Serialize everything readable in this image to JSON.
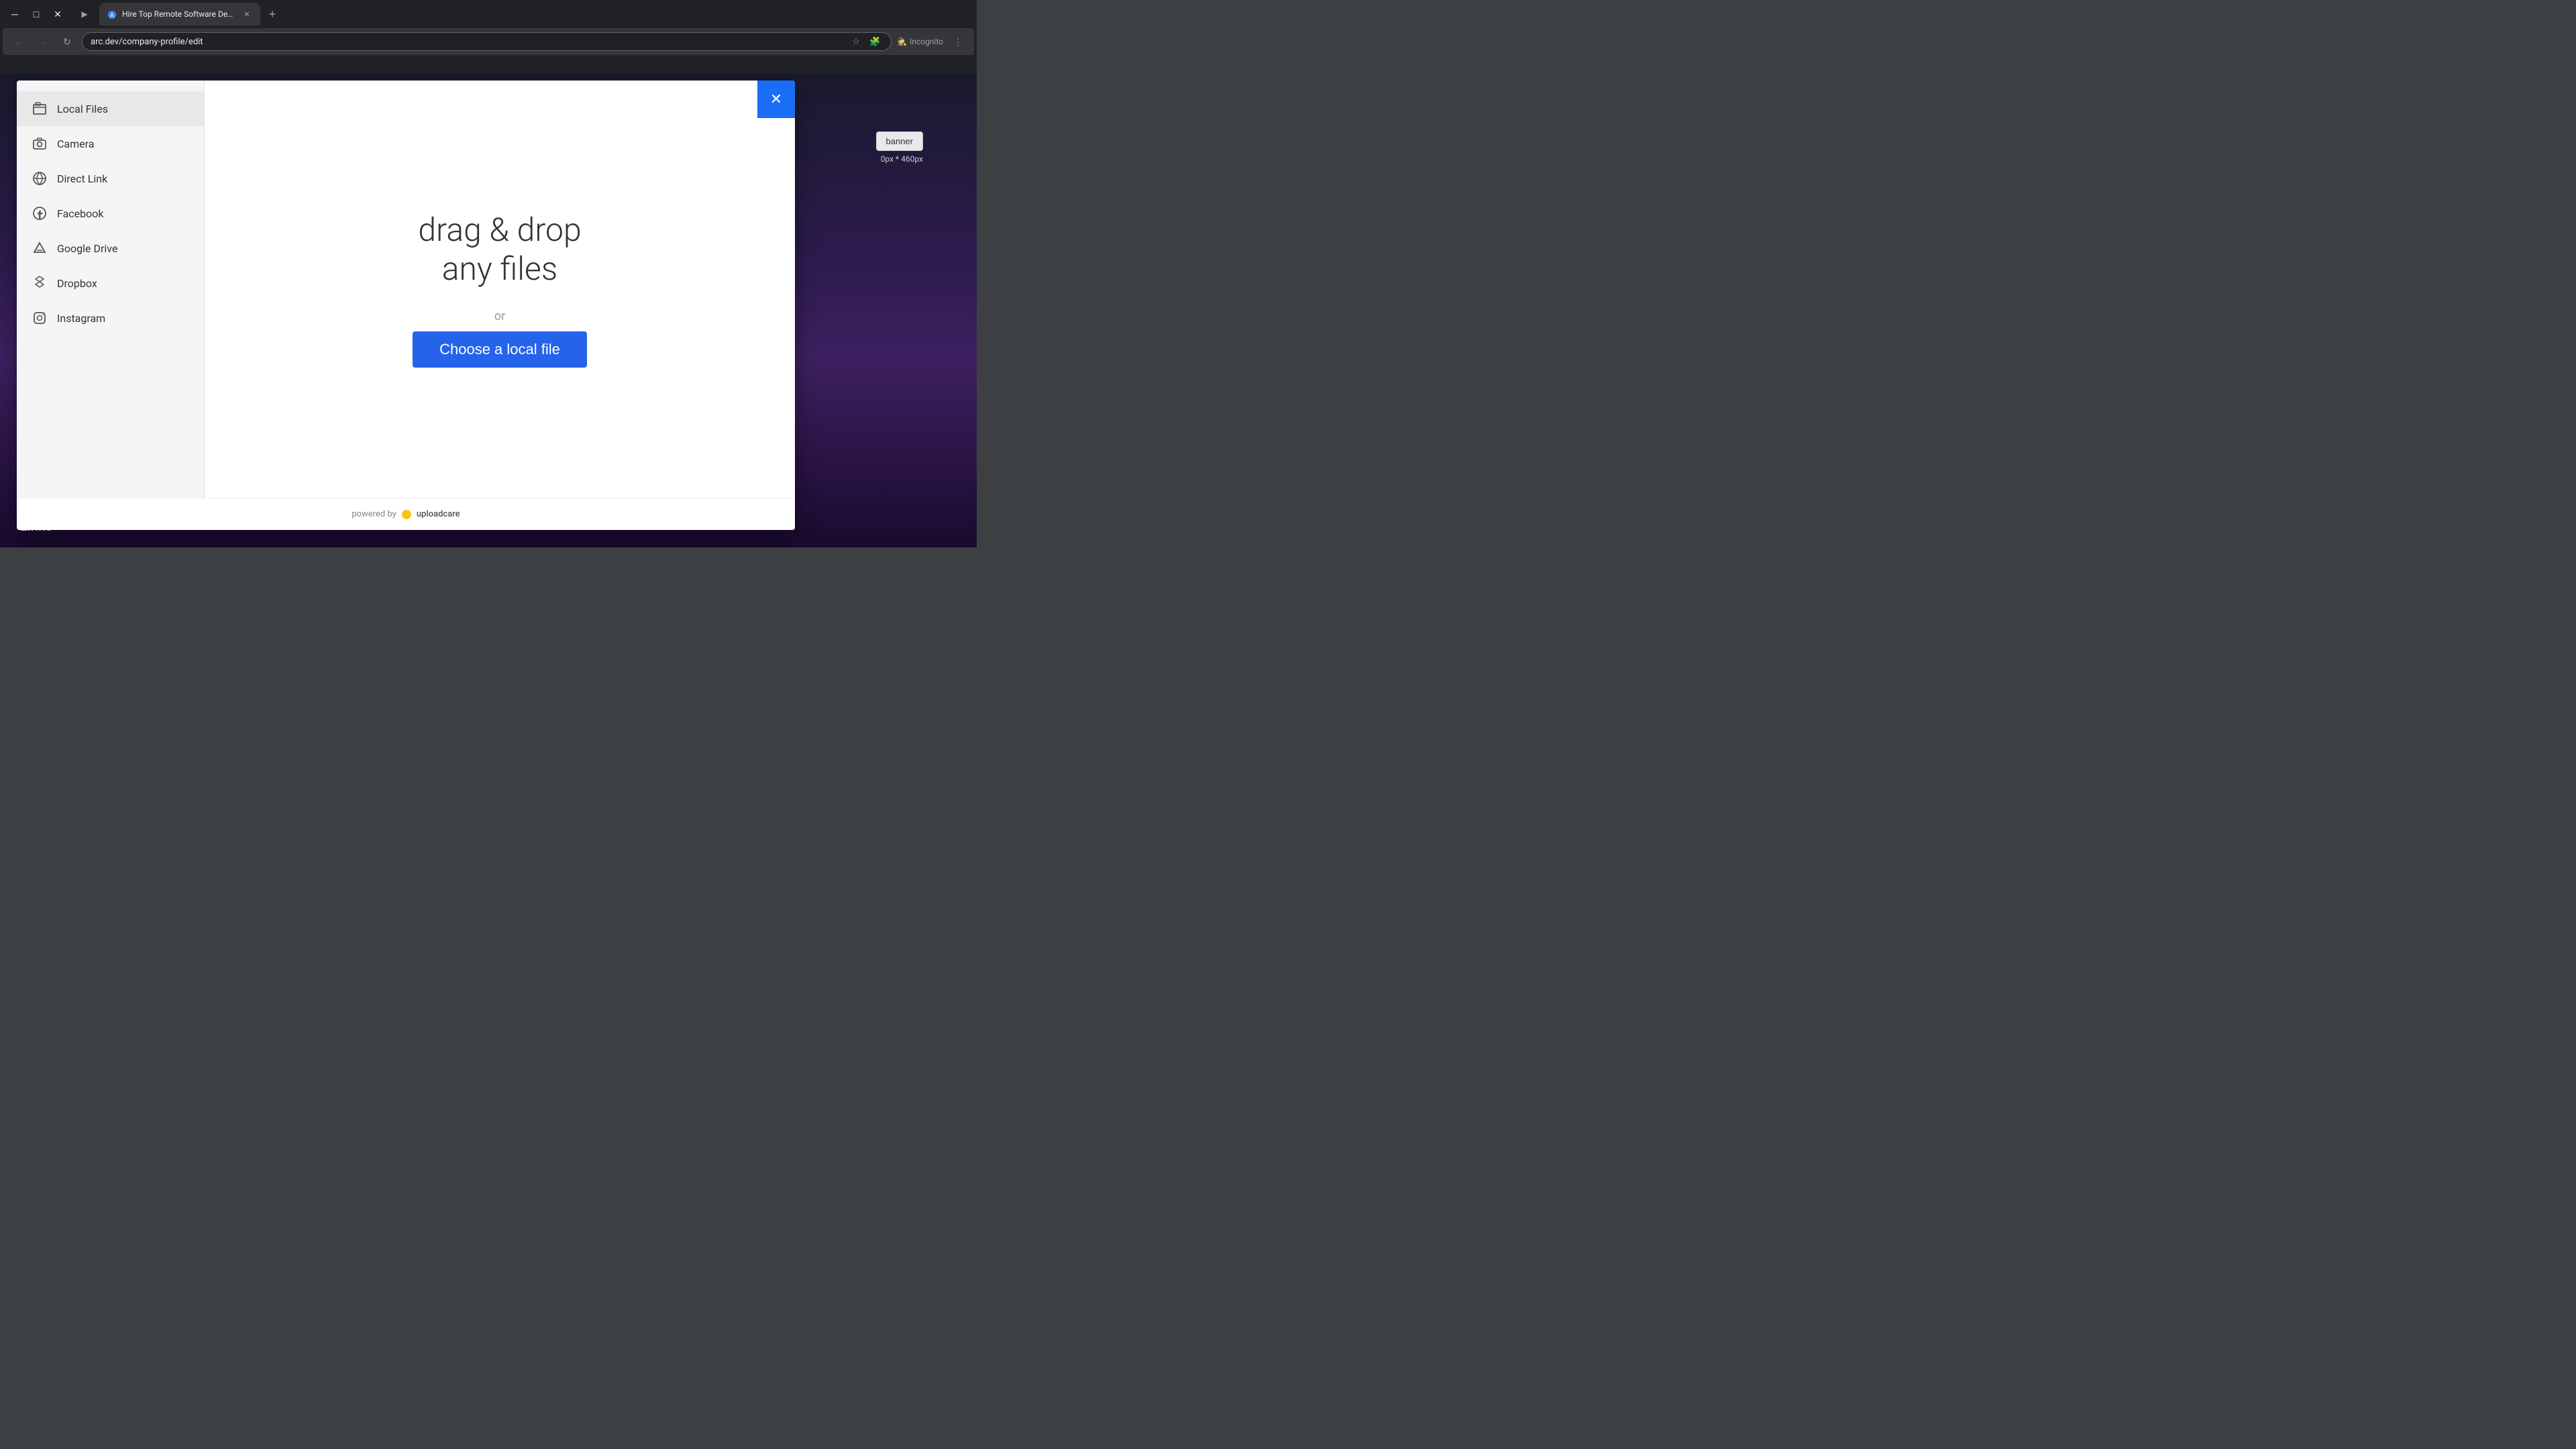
{
  "browser": {
    "tab_title": "Hire Top Remote Software Dev...",
    "url": "arc.dev/company-profile/edit",
    "incognito_label": "Incognito",
    "new_tab_tooltip": "New tab"
  },
  "modal": {
    "sidebar": {
      "header_label": "Local Files",
      "items": [
        {
          "id": "camera",
          "label": "Camera",
          "icon": "📷"
        },
        {
          "id": "direct-link",
          "label": "Direct Link",
          "icon": "🔗"
        },
        {
          "id": "facebook",
          "label": "Facebook",
          "icon": "f"
        },
        {
          "id": "google-drive",
          "label": "Google Drive",
          "icon": "△"
        },
        {
          "id": "dropbox",
          "label": "Dropbox",
          "icon": "◻"
        },
        {
          "id": "instagram",
          "label": "Instagram",
          "icon": "◉"
        }
      ]
    },
    "main": {
      "drag_drop_line1": "drag & drop",
      "drag_drop_line2": "any files",
      "or_label": "or",
      "choose_file_label": "Choose a local file"
    },
    "footer": {
      "powered_by": "powered by",
      "brand": "uploadcare"
    },
    "close_icon": "✕"
  },
  "page": {
    "banner_button": "banner",
    "banner_size": "0px * 460px",
    "links_label": "Links"
  }
}
